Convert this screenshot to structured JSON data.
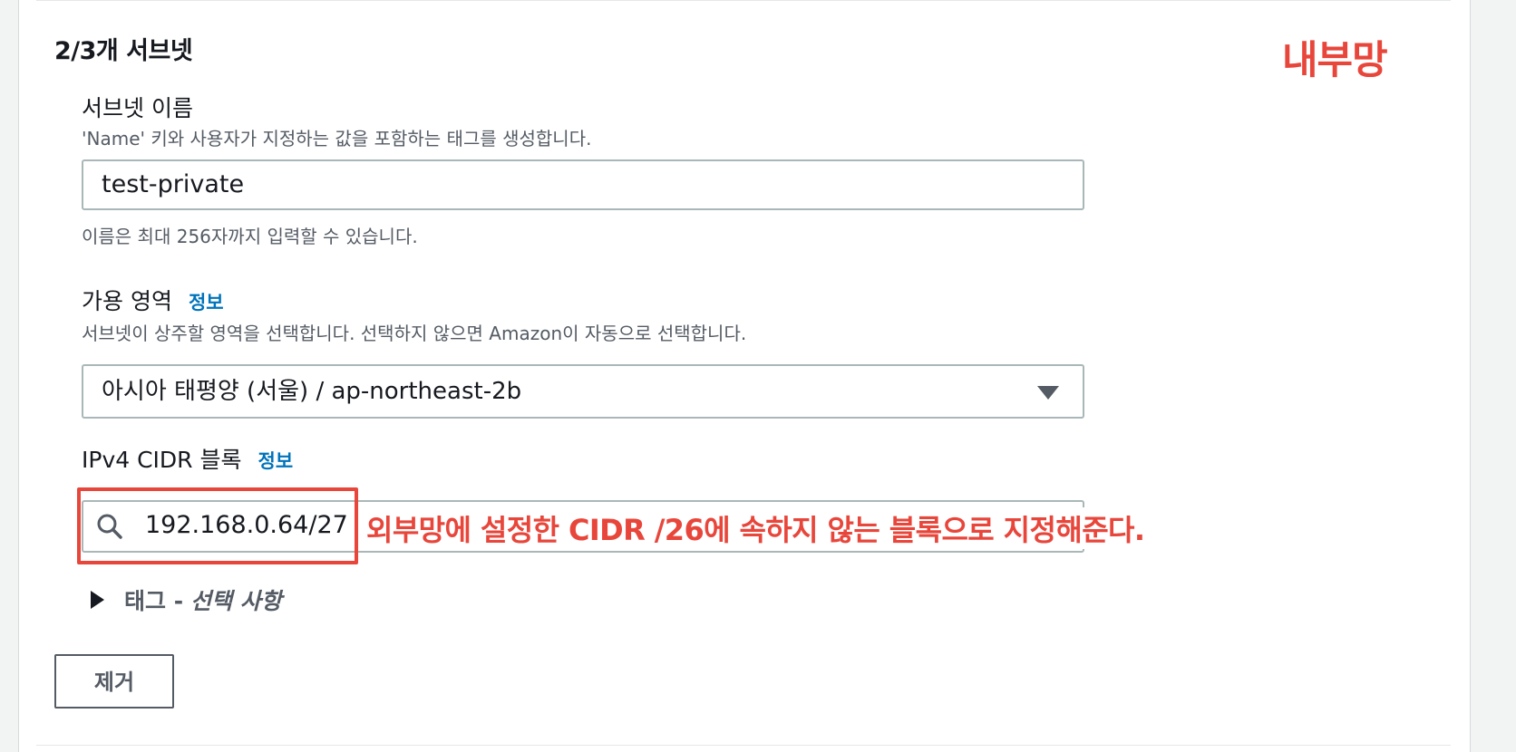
{
  "section": {
    "title": "2/3개 서브넷",
    "annotation": "내부망"
  },
  "subnet_name": {
    "label": "서브넷 이름",
    "description": "'Name' 키와 사용자가 지정하는 값을 포함하는 태그를 생성합니다.",
    "value": "test-private",
    "hint": "이름은 최대 256자까지 입력할 수 있습니다."
  },
  "availability_zone": {
    "label": "가용 영역",
    "info_link": "정보",
    "description": "서브넷이 상주할 영역을 선택합니다. 선택하지 않으면 Amazon이 자동으로 선택합니다.",
    "selected": "아시아 태평양 (서울) / ap-northeast-2b"
  },
  "ipv4_cidr": {
    "label": "IPv4 CIDR 블록",
    "info_link": "정보",
    "value": "192.168.0.64/27",
    "annotation": "외부망에 설정한 CIDR /26에 속하지 않는 블록으로 지정해준다.",
    "annotation_color": "#e8463b"
  },
  "tags": {
    "label": "태그 -",
    "optional": "선택 사항"
  },
  "actions": {
    "remove_label": "제거"
  },
  "colors": {
    "accent_link": "#0073bb",
    "annotation_red": "#e8463b",
    "border": "#aab7b8"
  }
}
